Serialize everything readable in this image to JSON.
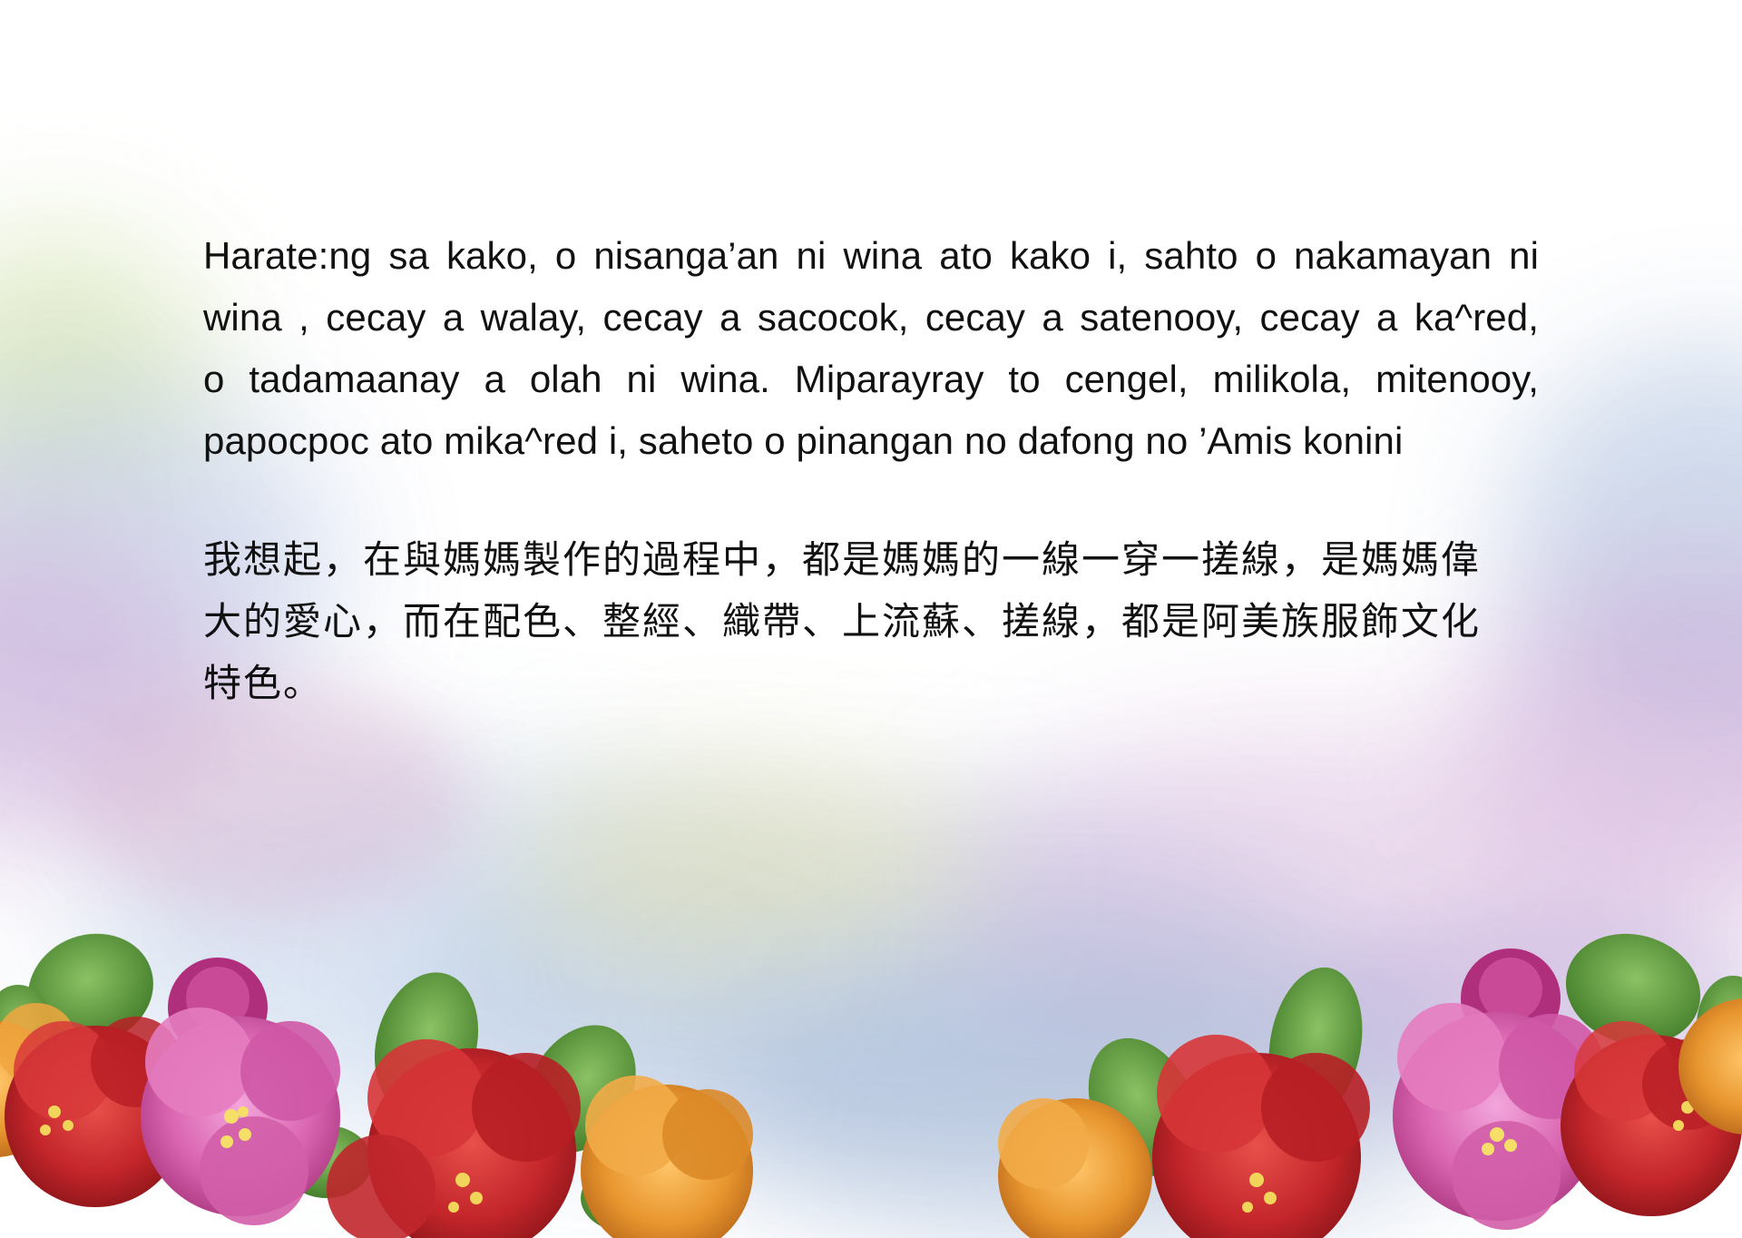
{
  "amis_paragraph": {
    "lines": [
      "Harate:ng sa kako, o nisanga’an ni wina ato kako i, sahto o nakamayan ni",
      "wina , cecay a walay, cecay a sacocok, cecay a satenooy, cecay a ka^red,",
      "o tadamaanay a olah ni wina. Miparayray to cengel, milikola, mitenooy,",
      "papocpoc ato mika^red i, saheto o pinangan no dafong no ’Amis konini"
    ]
  },
  "mandarin_paragraph": {
    "text": "我想起，在與媽媽製作的過程中，都是媽媽的一線一穿一搓線，是媽媽偉大的愛心，而在配色、整經、織帶、上流蘇、搓線，都是阿美族服飾文化特色。"
  },
  "colors": {
    "text": "#111111",
    "flower_red": "#c4262b",
    "flower_pink": "#d964b0",
    "flower_orange": "#e8962e",
    "leaf_green": "#5a9a3a",
    "wash_blue": "#9fb6d8",
    "wash_purple": "#b89ac8",
    "wash_green": "#c8d8a0"
  }
}
